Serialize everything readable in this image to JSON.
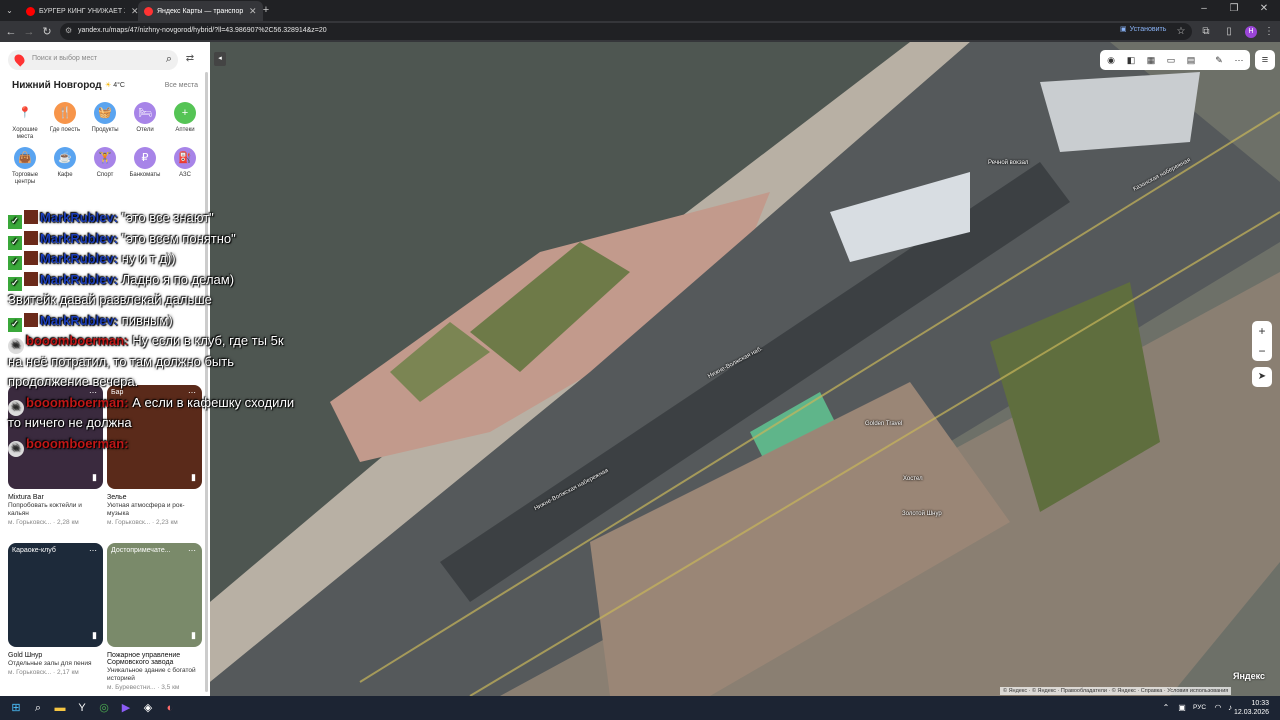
{
  "browser": {
    "tabs": [
      {
        "title": "БУРГЕР КИНГ УНИЖАЕТ ЖЕНЩ",
        "active": false,
        "favicon_color": "#ff0000"
      },
      {
        "title": "Яндекс Карты — транспорт, н",
        "active": true,
        "favicon_color": "#ff3333"
      }
    ],
    "url": "yandex.ru/maps/47/nizhny-novgorod/hybrid/?ll=43.986907%2C56.328914&z=20",
    "install_label": "Установить",
    "profile_initial": "Н"
  },
  "sidebar": {
    "search_placeholder": "Поиск и выбор мест",
    "city": "Нижний Новгород",
    "temperature": "4°C",
    "all_places": "Все места",
    "categories": [
      {
        "label": "Хорошие места",
        "color": "#ffffff",
        "icon": "pin-star-icon"
      },
      {
        "label": "Где поесть",
        "color": "#f7954a",
        "icon": "fork-knife-icon"
      },
      {
        "label": "Продукты",
        "color": "#5aa4f0",
        "icon": "basket-icon"
      },
      {
        "label": "Отели",
        "color": "#a784e8",
        "icon": "bed-icon"
      },
      {
        "label": "Аптеки",
        "color": "#55c455",
        "icon": "plus-icon"
      },
      {
        "label": "Торговые центры",
        "color": "#5aa4f0",
        "icon": "bag-icon"
      },
      {
        "label": "Кафе",
        "color": "#5aa4f0",
        "icon": "cup-icon"
      },
      {
        "label": "Спорт",
        "color": "#a784e8",
        "icon": "dumbbell-icon"
      },
      {
        "label": "Банкоматы",
        "color": "#a784e8",
        "icon": "ruble-icon"
      },
      {
        "label": "АЗС",
        "color": "#a784e8",
        "icon": "fuel-icon"
      }
    ],
    "cards": [
      {
        "tag": "",
        "name": "Mixtura Bar",
        "desc": "Попробовать коктейли и кальян",
        "addr": "м. Горьковск... · 2,28 км",
        "color": "#3a2a3e"
      },
      {
        "tag": "Бар",
        "name": "Зелье",
        "desc": "Уютная атмосфера и рок-музыка",
        "addr": "м. Горьковск... · 2,23 км",
        "color": "#5a2a1a"
      },
      {
        "tag": "Караоке-клуб",
        "name": "Gold Шнур",
        "desc": "Отдельные залы для пения",
        "addr": "м. Горьковск... · 2,17 км",
        "color": "#1d2a3a"
      },
      {
        "tag": "Достопримечате...",
        "name": "Пожарное управление Сормовского завода",
        "desc": "Уникальное здание с богатой историей",
        "addr": "м. Буревестни... · 3,5 км",
        "color": "#7a8a6a"
      }
    ]
  },
  "chat": {
    "messages": [
      {
        "user": "MarkRublev:",
        "text": "\"это все знают\"",
        "type": "mark"
      },
      {
        "user": "MarkRublev:",
        "text": "\"это всем понятно\"",
        "type": "mark"
      },
      {
        "user": "MarkRublev:",
        "text": "ну и т д))",
        "type": "mark"
      },
      {
        "user": "MarkRublev:",
        "text": "Ладно я по делам)",
        "type": "mark"
      },
      {
        "user": "",
        "text": "Звитейк давай развлекай дальше",
        "type": "cont"
      },
      {
        "user": "MarkRublev:",
        "text": "пивным)",
        "type": "mark"
      },
      {
        "user": "booomboerman:",
        "text": "Ну если в клуб, где ты 5к",
        "type": "boom"
      },
      {
        "user": "",
        "text": "на неё потратил, то там должно быть",
        "type": "cont"
      },
      {
        "user": "",
        "text": "продолжение вечера.",
        "type": "cont"
      },
      {
        "user": "booomboerman:",
        "text": "А если в кафешку сходили",
        "type": "boom"
      },
      {
        "user": "",
        "text": "то ничего не должна",
        "type": "cont"
      },
      {
        "user": "booomboerman:",
        "text": "",
        "type": "boom"
      }
    ]
  },
  "map": {
    "labels": [
      {
        "text": "Речной вокзал"
      },
      {
        "text": "Нижне-Волжская наб."
      },
      {
        "text": "Нижне-Волжская набережная"
      },
      {
        "text": "Golden Travel"
      },
      {
        "text": "Хостел"
      },
      {
        "text": "Золотой Шнур"
      },
      {
        "text": "Казанская набережная"
      }
    ],
    "copyright": "© Яндекс · © Яндекс · Правообладатели · © Яндекс · Справка · Условия использования",
    "logo": "Яндекс"
  },
  "taskbar": {
    "language": "РУС",
    "time": "10:33",
    "date": "12.03.2026"
  }
}
